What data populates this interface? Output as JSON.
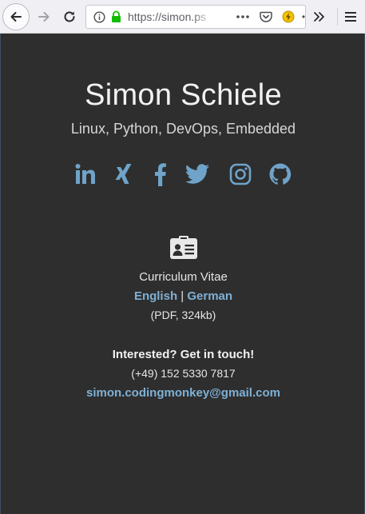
{
  "browser": {
    "url": "https://simon.ps",
    "icons": [
      "back-icon",
      "forward-icon",
      "reload-icon",
      "info-icon",
      "lock-icon",
      "page-actions-icon",
      "pocket-icon",
      "extension-icon",
      "overflow-chevrons-icon",
      "hamburger-menu-icon"
    ]
  },
  "profile": {
    "name": "Simon Schiele",
    "tagline": "Linux, Python, DevOps, Embedded"
  },
  "socials": [
    {
      "network": "LinkedIn",
      "icon": "linkedin-icon"
    },
    {
      "network": "Xing",
      "icon": "xing-icon"
    },
    {
      "network": "Facebook",
      "icon": "facebook-icon"
    },
    {
      "network": "Twitter",
      "icon": "twitter-icon"
    },
    {
      "network": "Instagram",
      "icon": "instagram-icon"
    },
    {
      "network": "GitHub",
      "icon": "github-icon"
    }
  ],
  "cv": {
    "icon": "id-card-icon",
    "title": "Curriculum Vitae",
    "english_label": "English",
    "separator": "|",
    "german_label": "German",
    "format": "(PDF, 324kb)"
  },
  "contact": {
    "heading": "Interested? Get in touch!",
    "phone": "(+49) 152 5330 7817",
    "email": "simon.codingmonkey@gmail.com"
  },
  "colors": {
    "background": "#2e2e2e",
    "accent": "#6fa3c9",
    "link": "#7fb0d6",
    "text": "#e6e6e6"
  }
}
